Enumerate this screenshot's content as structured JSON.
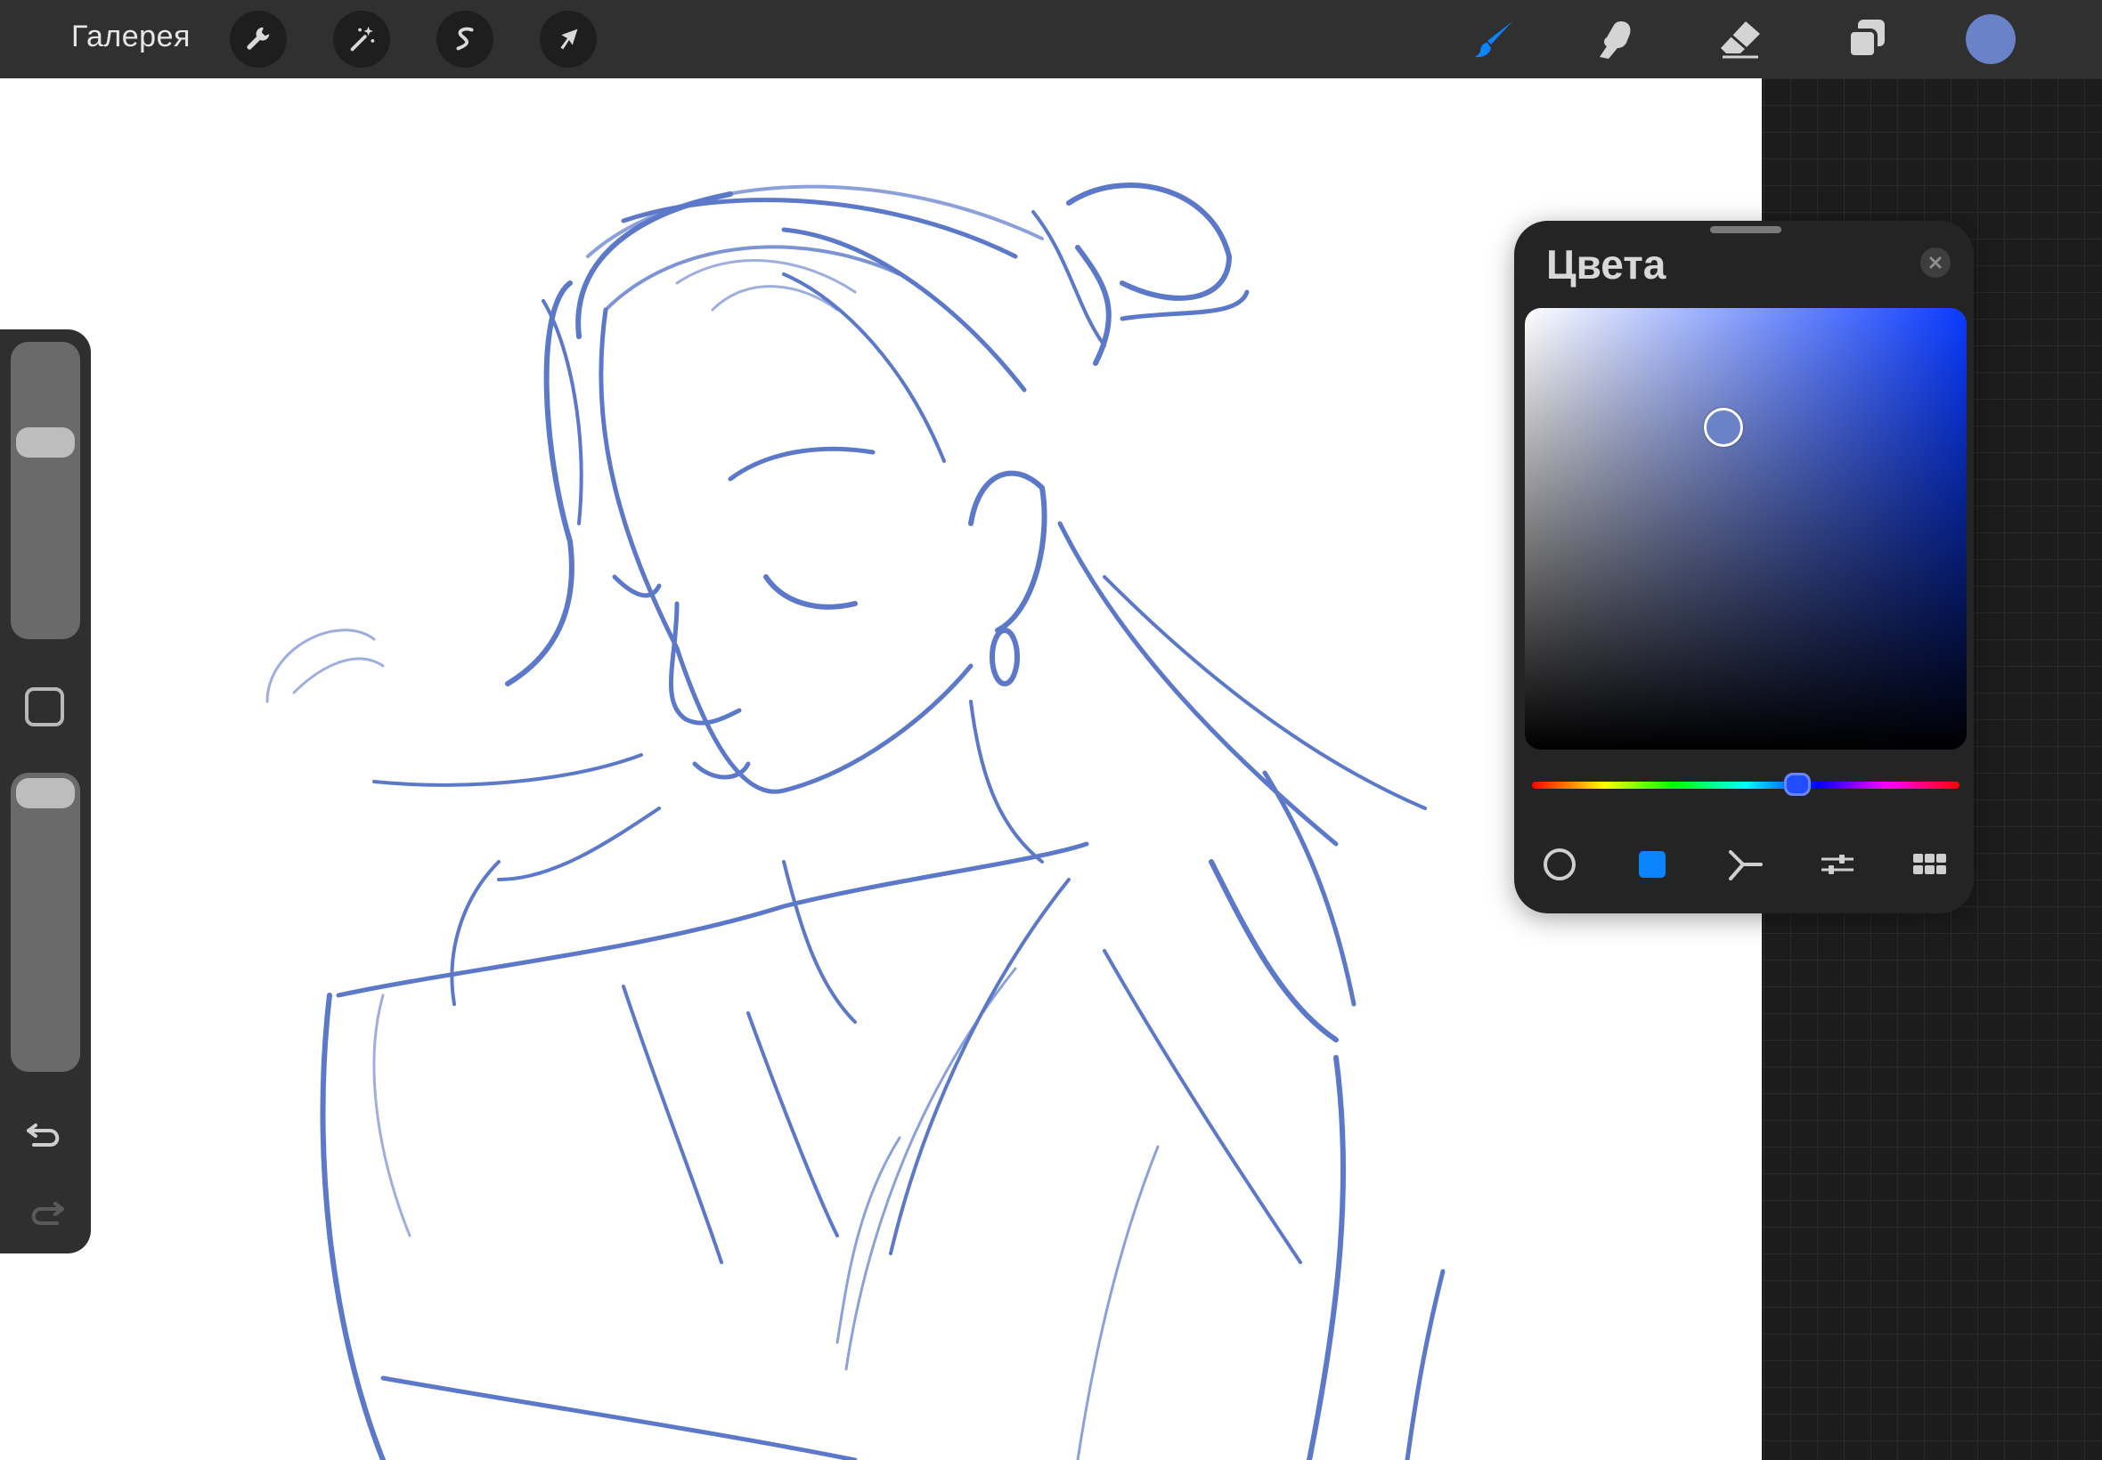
{
  "topbar": {
    "gallery_label": "Галерея",
    "left_tools": [
      {
        "name": "actions",
        "icon": "wrench-icon"
      },
      {
        "name": "adjustments",
        "icon": "magic-wand-icon"
      },
      {
        "name": "selection",
        "icon": "selection-s-icon"
      },
      {
        "name": "transform",
        "icon": "arrow-cursor-icon"
      }
    ],
    "right_tools": [
      {
        "name": "brush",
        "icon": "brush-icon",
        "active": true
      },
      {
        "name": "smudge",
        "icon": "smudge-finger-icon",
        "active": false
      },
      {
        "name": "eraser",
        "icon": "eraser-icon",
        "active": false
      },
      {
        "name": "layers",
        "icon": "layers-icon",
        "active": false
      }
    ],
    "current_color": "#6a82c8"
  },
  "sidebar": {
    "brush_size": 0.68,
    "opacity": 0.98,
    "icons": [
      "modify-square-icon",
      "undo-icon",
      "redo-icon"
    ]
  },
  "colors_panel": {
    "title": "Цвета",
    "hue_color": "#0a3bff",
    "saturation": 0.45,
    "brightness": 0.73,
    "hue": 0.62,
    "modes": [
      {
        "name": "disc",
        "icon": "disc-icon",
        "active": false
      },
      {
        "name": "classic",
        "icon": "classic-square-icon",
        "active": true
      },
      {
        "name": "harmony",
        "icon": "harmony-icon",
        "active": false
      },
      {
        "name": "value",
        "icon": "sliders-icon",
        "active": false
      },
      {
        "name": "palettes",
        "icon": "palette-grid-icon",
        "active": false
      }
    ]
  },
  "colors": {
    "accent": "#0a84ff",
    "stroke": "#5b78c9",
    "toolbar_bg": "#303030"
  }
}
